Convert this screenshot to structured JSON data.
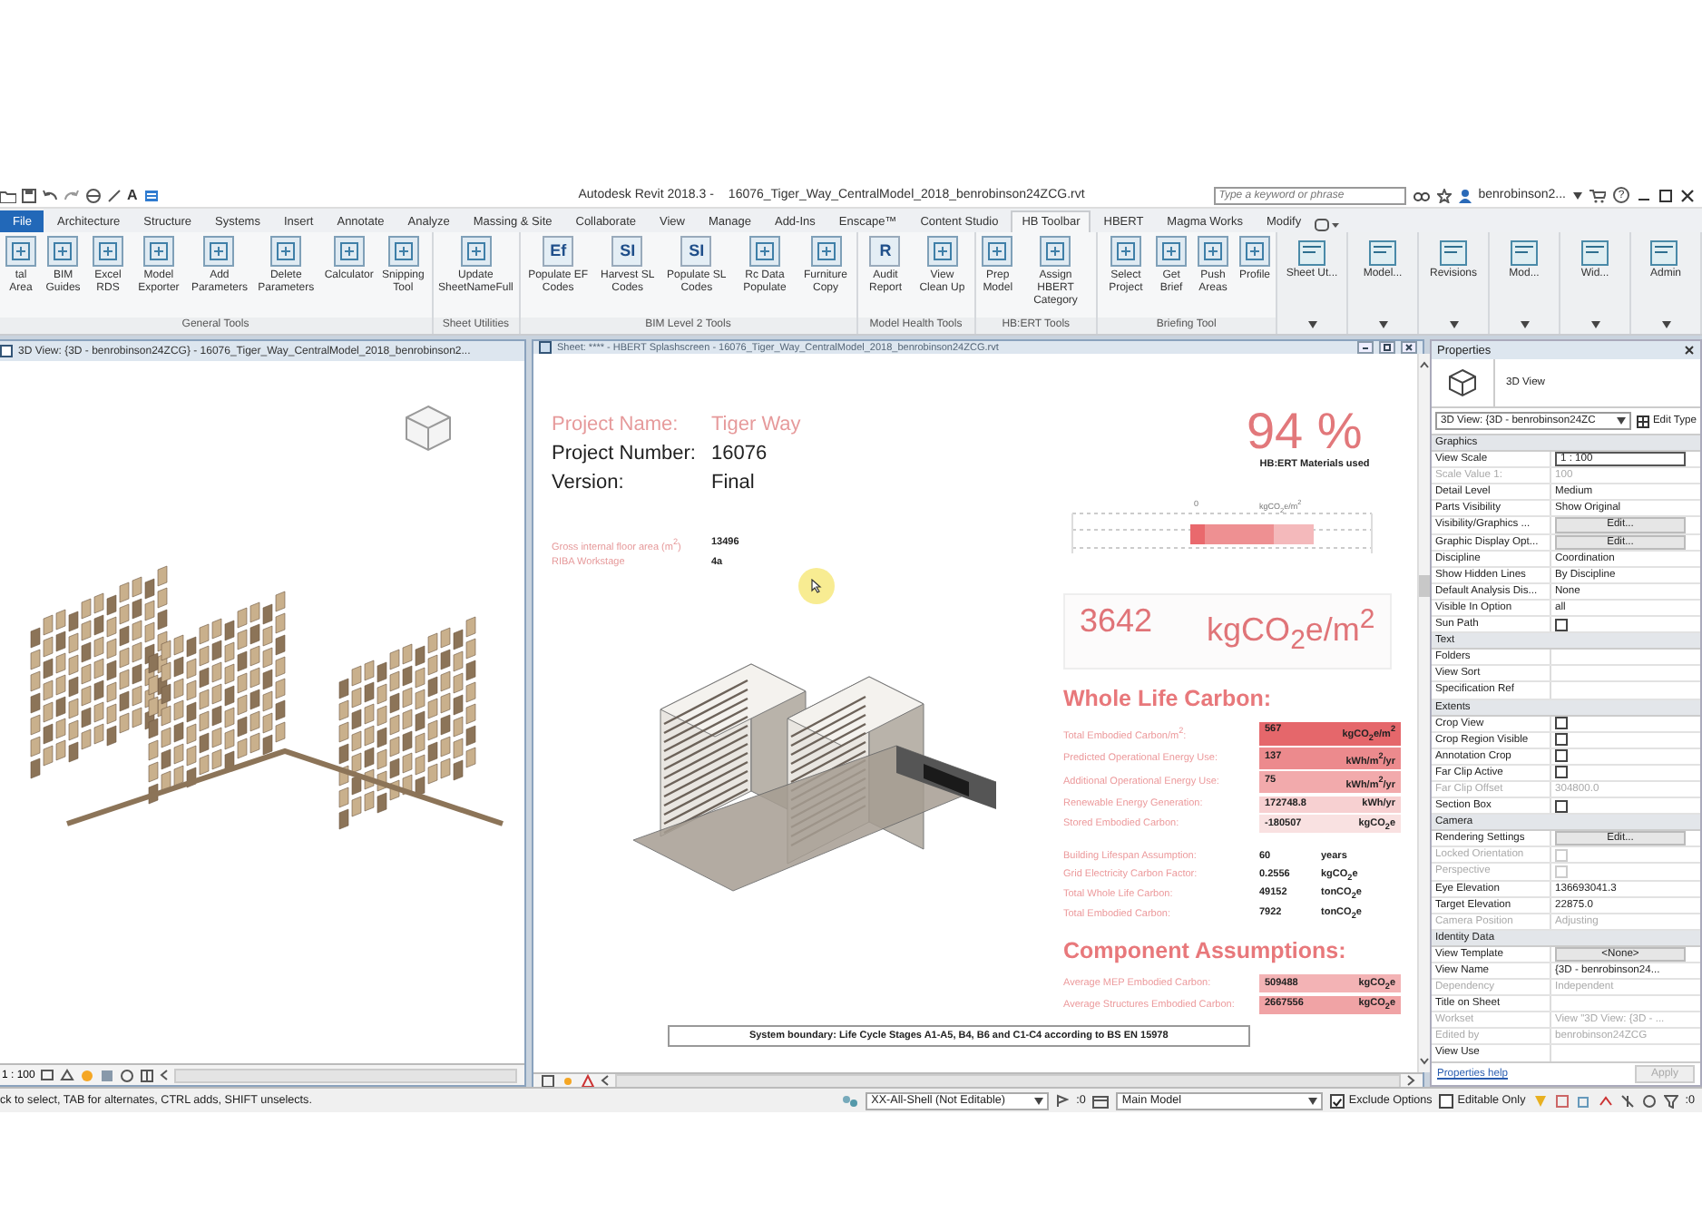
{
  "window": {
    "app": "Autodesk Revit 2018.3 -",
    "file": "16076_Tiger_Way_CentralModel_2018_benrobinson24ZCG.rvt",
    "quick_access_text": "A",
    "search": {
      "placeholder": "Type a keyword or phrase"
    },
    "user": "benrobinson2...",
    "help": "?"
  },
  "tabs": [
    {
      "label": "File",
      "kind": "app",
      "selected": false
    },
    {
      "label": "Architecture",
      "kind": "tab",
      "selected": false
    },
    {
      "label": "Structure",
      "kind": "tab",
      "selected": false
    },
    {
      "label": "Systems",
      "kind": "tab",
      "selected": false
    },
    {
      "label": "Insert",
      "kind": "tab",
      "selected": false
    },
    {
      "label": "Annotate",
      "kind": "tab",
      "selected": false
    },
    {
      "label": "Analyze",
      "kind": "tab",
      "selected": false
    },
    {
      "label": "Massing & Site",
      "kind": "tab",
      "selected": false
    },
    {
      "label": "Collaborate",
      "kind": "tab",
      "selected": false
    },
    {
      "label": "View",
      "kind": "tab",
      "selected": false
    },
    {
      "label": "Manage",
      "kind": "tab",
      "selected": false
    },
    {
      "label": "Add-Ins",
      "kind": "tab",
      "selected": false
    },
    {
      "label": "Enscape™",
      "kind": "tab",
      "selected": false
    },
    {
      "label": "Content Studio",
      "kind": "tab",
      "selected": false
    },
    {
      "label": "HB Toolbar",
      "kind": "tab",
      "selected": true
    },
    {
      "label": "HBERT",
      "kind": "tab",
      "selected": false
    },
    {
      "label": "Magma Works",
      "kind": "tab",
      "selected": false
    },
    {
      "label": "Modify",
      "kind": "tab",
      "selected": false
    }
  ],
  "ribbon": {
    "groups": [
      {
        "label": "General Tools",
        "tools": [
          {
            "label": "tal Area"
          },
          {
            "label": "BIM Guides"
          },
          {
            "label": "Excel RDS"
          },
          {
            "label": "Model Exporter"
          },
          {
            "label": "Add Parameters"
          },
          {
            "label": "Delete Parameters"
          },
          {
            "label": "Calculator"
          },
          {
            "label": "Snipping Tool"
          }
        ]
      },
      {
        "label": "Sheet Utilities",
        "tools": [
          {
            "label": "Update SheetNameFull"
          }
        ]
      },
      {
        "label": "BIM Level 2 Tools",
        "tools": [
          {
            "label": "Populate EF Codes",
            "icon_text": "Ef"
          },
          {
            "label": "Harvest SL Codes",
            "icon_text": "SI"
          },
          {
            "label": "Populate SL Codes",
            "icon_text": "SI"
          },
          {
            "label": "Rc Data Populate"
          },
          {
            "label": "Furniture Copy"
          }
        ]
      },
      {
        "label": "Model Health Tools",
        "tools": [
          {
            "label": "Audit Report",
            "icon_text": "R"
          },
          {
            "label": "View Clean Up"
          }
        ]
      },
      {
        "label": "HB:ERT Tools",
        "tools": [
          {
            "label": "Prep Model"
          },
          {
            "label": "Assign HBERT Category"
          }
        ]
      },
      {
        "label": "Briefing Tool",
        "tools": [
          {
            "label": "Select Project"
          },
          {
            "label": "Get Brief"
          },
          {
            "label": "Push Areas"
          },
          {
            "label": "Profile"
          }
        ]
      }
    ],
    "dropdowns": [
      {
        "label": "Sheet Ut..."
      },
      {
        "label": "Model..."
      },
      {
        "label": "Revisions"
      },
      {
        "label": "Mod..."
      },
      {
        "label": "Wid..."
      },
      {
        "label": "Admin"
      }
    ]
  },
  "left_view": {
    "title": "3D View: {3D - benrobinson24ZCG} - 16076_Tiger_Way_CentralModel_2018_benrobinson2...",
    "scale": "1 : 100"
  },
  "sheet": {
    "title": "Sheet: **** - HBERT Splashscreen - 16076_Tiger_Way_CentralModel_2018_benrobinson24ZCG.rvt",
    "project": [
      {
        "label": "Project Name:",
        "value": "Tiger Way",
        "kind": "accent"
      },
      {
        "label": "Project Number:",
        "value": "16076",
        "kind": "plain"
      },
      {
        "label": "Version:",
        "value": "Final",
        "kind": "plain"
      }
    ],
    "details": [
      {
        "label": "Gross internal floor area (m$^{2}$)",
        "value": "13496"
      },
      {
        "label": "RIBA Workstage",
        "value": "4a"
      }
    ],
    "materials": {
      "percent": "94 %",
      "caption": "HB:ERT Materials used"
    },
    "benchmark": {
      "tick": "0",
      "unit": "kgCO$_{2}$e/m$^{2}$"
    },
    "headline": {
      "value": "3642",
      "unit": "kgCO$_{2}$e/m$^{2}$"
    },
    "whole_life": {
      "heading": "Whole Life Carbon:",
      "highlighted": [
        {
          "label": "Total Embodied Carbon/m$^{2}$:",
          "value": "567",
          "unit": "kgCO$_{2}$e/m$^{2}$",
          "color": "#e5676b"
        },
        {
          "label": "Predicted Operational Energy Use:",
          "value": "137",
          "unit": "kWh/m$^{2}$/yr",
          "color": "#ec8a8d"
        },
        {
          "label": "Additional Operational Energy Use:",
          "value": "75",
          "unit": "kWh/m$^{2}$/yr",
          "color": "#f2aaac"
        },
        {
          "label": "Renewable Energy Generation:",
          "value": "172748.8",
          "unit": "kWh/yr",
          "color": "#f7d0d1"
        },
        {
          "label": "Stored Embodied Carbon:",
          "value": "-180507",
          "unit": "kgCO$_{2}$e",
          "color": "#f9e1e1"
        }
      ],
      "plain": [
        {
          "label": "Building Lifespan Assumption:",
          "value": "60",
          "unit": "years"
        },
        {
          "label": "Grid Electricity Carbon Factor:",
          "value": "0.2556",
          "unit": "kgCO$_{2}$e"
        },
        {
          "label": "Total Whole Life Carbon:",
          "value": "49152",
          "unit": "tonCO$_{2}$e"
        },
        {
          "label": "Total Embodied Carbon:",
          "value": "7922",
          "unit": "tonCO$_{2}$e"
        }
      ]
    },
    "components": {
      "heading": "Component Assumptions:",
      "rows": [
        {
          "label": "Average MEP Embodied Carbon:",
          "value": "509488",
          "unit": "kgCO$_{2}$e",
          "color": "#f3b3b5"
        },
        {
          "label": "Average Structures Embodied Carbon:",
          "value": "2667556",
          "unit": "kgCO$_{2}$e",
          "color": "#f0a3a5"
        }
      ]
    },
    "footnote": "System boundary: Life Cycle Stages A1-A5, B4, B6 and C1-C4 according to BS EN 15978"
  },
  "properties": {
    "title": "Properties",
    "type": "3D View",
    "selector": "3D View: {3D - benrobinson24ZC",
    "edit_type": "Edit Type",
    "sections": [
      {
        "name": "Graphics",
        "rows": [
          {
            "label": "View Scale",
            "kind": "field",
            "value": "1 : 100",
            "disabled": false
          },
          {
            "label": "Scale Value    1:",
            "kind": "text",
            "value": "100",
            "disabled": true
          },
          {
            "label": "Detail Level",
            "kind": "text",
            "value": "Medium",
            "disabled": false
          },
          {
            "label": "Parts Visibility",
            "kind": "text",
            "value": "Show Original",
            "disabled": false
          },
          {
            "label": "Visibility/Graphics ...",
            "kind": "button",
            "value": "Edit...",
            "disabled": false
          },
          {
            "label": "Graphic Display Opt...",
            "kind": "button",
            "value": "Edit...",
            "disabled": false
          },
          {
            "label": "Discipline",
            "kind": "text",
            "value": "Coordination",
            "disabled": false
          },
          {
            "label": "Show Hidden Lines",
            "kind": "text",
            "value": "By Discipline",
            "disabled": false
          },
          {
            "label": "Default Analysis Dis...",
            "kind": "text",
            "value": "None",
            "disabled": false
          },
          {
            "label": "Visible In Option",
            "kind": "text",
            "value": "all",
            "disabled": false
          },
          {
            "label": "Sun Path",
            "kind": "checkbox",
            "checked": false,
            "disabled": false
          }
        ]
      },
      {
        "name": "Text",
        "rows": [
          {
            "label": "Folders",
            "kind": "text",
            "disabled": false
          },
          {
            "label": "View Sort",
            "kind": "text",
            "disabled": false
          },
          {
            "label": "Specification Ref",
            "kind": "text",
            "disabled": false
          }
        ]
      },
      {
        "name": "Extents",
        "rows": [
          {
            "label": "Crop View",
            "kind": "checkbox",
            "checked": false,
            "disabled": false
          },
          {
            "label": "Crop Region Visible",
            "kind": "checkbox",
            "checked": false,
            "disabled": false
          },
          {
            "label": "Annotation Crop",
            "kind": "checkbox",
            "checked": false,
            "disabled": false
          },
          {
            "label": "Far Clip Active",
            "kind": "checkbox",
            "checked": false,
            "disabled": false
          },
          {
            "label": "Far Clip Offset",
            "kind": "text",
            "value": "304800.0",
            "disabled": true
          },
          {
            "label": "Section Box",
            "kind": "checkbox",
            "checked": false,
            "disabled": false
          }
        ]
      },
      {
        "name": "Camera",
        "rows": [
          {
            "label": "Rendering Settings",
            "kind": "button",
            "value": "Edit...",
            "disabled": false
          },
          {
            "label": "Locked Orientation",
            "kind": "checkbox",
            "checked": false,
            "disabled": true
          },
          {
            "label": "Perspective",
            "kind": "checkbox",
            "checked": false,
            "disabled": true
          },
          {
            "label": "Eye Elevation",
            "kind": "text",
            "value": "136693041.3",
            "disabled": false
          },
          {
            "label": "Target Elevation",
            "kind": "text",
            "value": "22875.0",
            "disabled": false
          },
          {
            "label": "Camera Position",
            "kind": "text",
            "value": "Adjusting",
            "disabled": true
          }
        ]
      },
      {
        "name": "Identity Data",
        "rows": [
          {
            "label": "View Template",
            "kind": "button",
            "value": "<None>",
            "disabled": false
          },
          {
            "label": "View Name",
            "kind": "text",
            "value": "{3D - benrobinson24...",
            "disabled": false
          },
          {
            "label": "Dependency",
            "kind": "text",
            "value": "Independent",
            "disabled": true
          },
          {
            "label": "Title on Sheet",
            "kind": "text",
            "disabled": false
          },
          {
            "label": "Workset",
            "kind": "text",
            "value": "View \"3D View: {3D - ...",
            "disabled": true
          },
          {
            "label": "Edited by",
            "kind": "text",
            "value": "benrobinson24ZCG",
            "disabled": true
          },
          {
            "label": "View Use",
            "kind": "text",
            "disabled": false
          }
        ]
      }
    ],
    "help_link": "Properties help",
    "apply": {
      "label": "Apply",
      "disabled": true
    }
  },
  "status_bar": {
    "hint": "ck to select, TAB for alternates, CTRL adds, SHIFT unselects.",
    "workset": "XX-All-Shell (Not Editable)",
    "workset_count": ":0",
    "design_option": "Main Model",
    "exclude_options": {
      "label": "Exclude Options",
      "checked": true
    },
    "editable_only": {
      "label": "Editable Only",
      "checked": false
    },
    "filter_count": ":0"
  }
}
